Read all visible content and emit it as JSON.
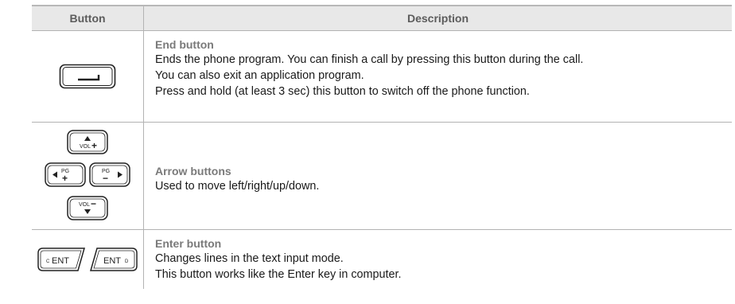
{
  "table": {
    "header": {
      "button_col": "Button",
      "description_col": "Description"
    },
    "rows": [
      {
        "icon": "end-key-icon",
        "title": "End button",
        "lines": [
          "Ends the phone program. You can finish a call by pressing this button during the call.",
          "You can also exit an application program.",
          "Press and hold (at least 3 sec) this button to switch off the phone function."
        ]
      },
      {
        "icon": "arrow-keys-icon",
        "title": "Arrow buttons",
        "lines": [
          "Used to move left/right/up/down."
        ],
        "keys": {
          "up_label": "VOL",
          "up_sign": "+",
          "down_label": "VOL",
          "down_sign": "−",
          "left_label": "PG",
          "left_sign": "+",
          "right_label": "PG",
          "right_sign": "−"
        }
      },
      {
        "icon": "enter-keys-icon",
        "title": "Enter button",
        "lines": [
          "Changes lines in the text input mode.",
          "This button works like the Enter key in computer."
        ],
        "keys": {
          "left_prefix": "C",
          "left_label": "ENT",
          "right_label": "ENT",
          "right_suffix": "D"
        }
      }
    ]
  }
}
